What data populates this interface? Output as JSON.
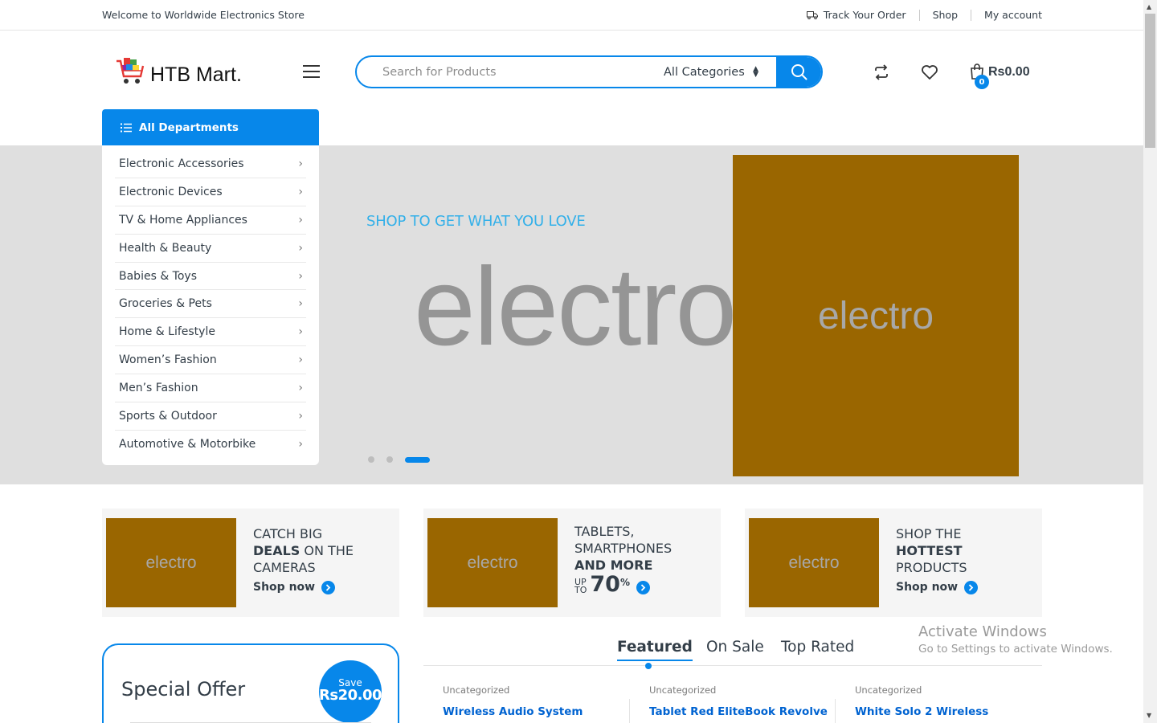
{
  "topbar": {
    "welcome": "Welcome to Worldwide Electronics Store",
    "track_order": "Track Your Order",
    "shop": "Shop",
    "my_account": "My account"
  },
  "header": {
    "logo_text": "HTB Mart.",
    "search_placeholder": "Search for Products",
    "category_select": "All Categories",
    "cart_count": "0",
    "cart_total": "Rs0.00"
  },
  "departments": {
    "title": "All Departments",
    "items": [
      {
        "label": "Electronic Accessories"
      },
      {
        "label": "Electronic Devices"
      },
      {
        "label": "TV & Home Appliances"
      },
      {
        "label": "Health & Beauty"
      },
      {
        "label": "Babies & Toys"
      },
      {
        "label": "Groceries & Pets"
      },
      {
        "label": "Home & Lifestyle"
      },
      {
        "label": "Women’s Fashion"
      },
      {
        "label": "Men’s Fashion"
      },
      {
        "label": "Sports & Outdoor"
      },
      {
        "label": "Automotive & Motorbike"
      }
    ]
  },
  "hero": {
    "tagline": "SHOP TO GET WHAT YOU LOVE",
    "big_word": "electro",
    "image_word": "electro",
    "slide_count": 3,
    "active_slide": 3
  },
  "promos": [
    {
      "image_word": "electro",
      "line1": "CATCH BIG",
      "bold": "DEALS",
      "line2": " ON THE",
      "line3": "CAMERAS",
      "shop": "Shop now"
    },
    {
      "image_word": "electro",
      "line1": "TABLETS,",
      "line2": "SMARTPHONES",
      "bold": "AND MORE",
      "upto_top": "UP",
      "upto_bottom": "TO",
      "percent_value": "70",
      "percent_sign": "%",
      "shop": "Shop now"
    },
    {
      "image_word": "electro",
      "line1": "SHOP THE",
      "bold": "HOTTEST",
      "line3": "PRODUCTS",
      "shop": "Shop now"
    }
  ],
  "special_offer": {
    "title": "Special Offer",
    "save_label": "Save",
    "save_value": "Rs20.00"
  },
  "tabs": [
    {
      "label": "Featured",
      "active": true
    },
    {
      "label": "On Sale",
      "active": false
    },
    {
      "label": "Top Rated",
      "active": false
    }
  ],
  "products": [
    {
      "category": "Uncategorized",
      "name": "Wireless Audio System"
    },
    {
      "category": "Uncategorized",
      "name": "Tablet Red EliteBook Revolve"
    },
    {
      "category": "Uncategorized",
      "name": "White Solo 2 Wireless"
    }
  ],
  "watermark": {
    "line1": "Activate Windows",
    "line2": "Go to Settings to activate Windows."
  },
  "colors": {
    "accent": "#0787ea",
    "tagline": "#33b0e9",
    "placeholder_image": "#9a6600",
    "hero_bg": "#dfdfdf"
  }
}
